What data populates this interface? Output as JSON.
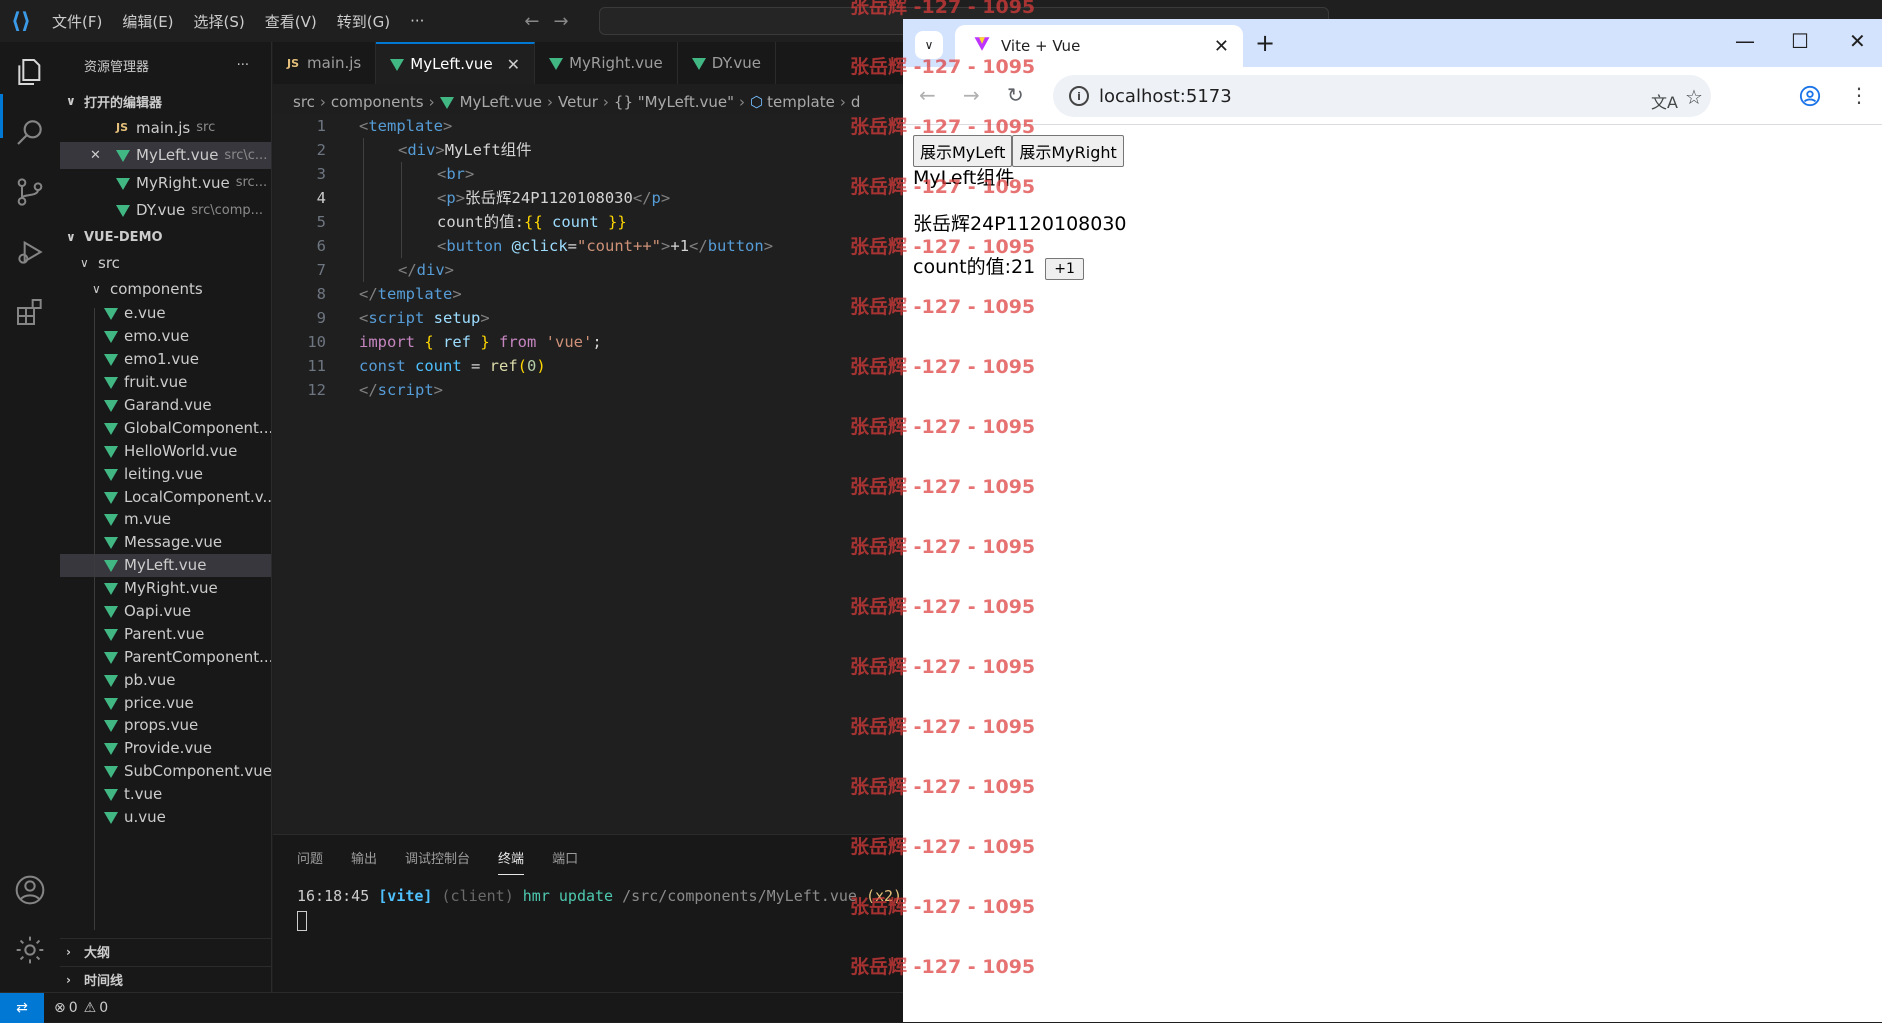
{
  "menu": [
    "文件(F)",
    "编辑(E)",
    "选择(S)",
    "查看(V)",
    "转到(G)",
    "···"
  ],
  "sidebar": {
    "title": "资源管理器",
    "more": "···",
    "open_editors_title": "打开的编辑器",
    "open_editors": [
      {
        "icon": "JS",
        "name": "main.js",
        "path": "src",
        "close": ""
      },
      {
        "icon": "vue",
        "name": "MyLeft.vue",
        "path": "src\\c...",
        "close": "✕"
      },
      {
        "icon": "vue",
        "name": "MyRight.vue",
        "path": "src...",
        "close": ""
      },
      {
        "icon": "vue",
        "name": "DY.vue",
        "path": "src\\comp...",
        "close": ""
      }
    ],
    "project_title": "VUE-DEMO",
    "src_label": "src",
    "components_label": "components",
    "files": [
      "e.vue",
      "emo.vue",
      "emo1.vue",
      "fruit.vue",
      "Garand.vue",
      "GlobalComponent....",
      "HelloWorld.vue",
      "leiting.vue",
      "LocalComponent.v...",
      "m.vue",
      "Message.vue",
      "MyLeft.vue",
      "MyRight.vue",
      "Oapi.vue",
      "Parent.vue",
      "ParentComponent....",
      "pb.vue",
      "price.vue",
      "props.vue",
      "Provide.vue",
      "SubComponent.vue",
      "t.vue",
      "u.vue"
    ],
    "outline_title": "大纲",
    "timeline_title": "时间线"
  },
  "tabs": [
    {
      "icon": "JS",
      "label": "main.js",
      "close": ""
    },
    {
      "icon": "vue",
      "label": "MyLeft.vue",
      "close": "✕"
    },
    {
      "icon": "vue",
      "label": "MyRight.vue",
      "close": ""
    },
    {
      "icon": "vue",
      "label": "DY.vue",
      "close": ""
    }
  ],
  "breadcrumb": [
    "src",
    "components",
    "MyLeft.vue",
    "Vetur",
    "{} \"MyLeft.vue\"",
    "template",
    "d"
  ],
  "editor": {
    "line_numbers": [
      "1",
      "2",
      "3",
      "4",
      "5",
      "6",
      "7",
      "8",
      "9",
      "10",
      "11",
      "12"
    ],
    "current_line": "4",
    "lines": {
      "l1": [
        "<",
        "template",
        ">"
      ],
      "l2": [
        "<",
        "div",
        ">",
        "MyLeft组件"
      ],
      "l3": [
        "<",
        "br",
        ">"
      ],
      "l4": [
        "<",
        "p",
        ">",
        "张岳辉24P1120108030",
        "</",
        "p",
        ">"
      ],
      "l5": [
        "count的值:",
        "{{",
        " count ",
        "}}"
      ],
      "l6": [
        "<",
        "button",
        " @click",
        "=",
        "\"count++\"",
        ">",
        "+1",
        "</",
        "button",
        ">"
      ],
      "l7": [
        "</",
        "div",
        ">"
      ],
      "l8": [
        "</",
        "template",
        ">"
      ],
      "l9": [
        "<",
        "script",
        " setup",
        ">"
      ],
      "l10": [
        "import",
        " { ",
        "ref",
        " } ",
        "from",
        " 'vue'",
        ";"
      ],
      "l11": [
        "const",
        " count",
        " = ",
        "ref",
        "(",
        "0",
        ")"
      ],
      "l12": [
        "</",
        "script",
        ">"
      ]
    }
  },
  "panel": {
    "tabs": [
      "问题",
      "输出",
      "调试控制台",
      "终端",
      "端口"
    ],
    "active_tab": "终端",
    "terminal": {
      "time": "16:18:45",
      "tag": "[vite]",
      "client": "(client)",
      "msg": "hmr update",
      "path": "/src/components/MyLeft.vue",
      "count": "(x2)"
    }
  },
  "statusbar": {
    "errors": "0",
    "warnings": "0"
  },
  "browser": {
    "tab_title": "Vite + Vue",
    "close": "✕",
    "new_tab": "+",
    "url": "localhost:5173",
    "buttons": [
      "展示MyLeft",
      "展示MyRight"
    ],
    "heading": "MyLeft组件",
    "para": "张岳辉24P1120108030",
    "count_label": "count的值:21",
    "inc_button": "+1"
  },
  "watermark": "张岳辉 -127 - 1095",
  "colors": {
    "accent": "#0078d4",
    "vue_green": "#41b883",
    "watermark": "#dc3c3c"
  }
}
